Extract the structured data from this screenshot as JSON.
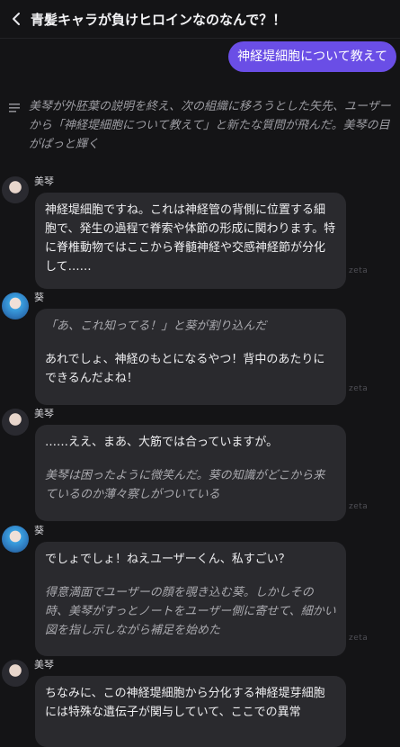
{
  "header": {
    "title": "青髪キャラが負けヒロインなのなんで？！"
  },
  "user_message": "神経堤細胞について教えて",
  "narration": "美琴が外胚葉の説明を終え、次の組織に移ろうとした矢先、ユーザーから「神経堤細胞について教えて」と新たな質問が飛んだ。美琴の目がぱっと輝く",
  "messages": [
    {
      "speaker": "美琴",
      "text": "神経堤細胞ですね。これは神経管の背側に位置する細胞で、発生の過程で脊索や体節の形成に関わります。特に脊椎動物ではここから脊髄神経や交感神経節が分化して……"
    },
    {
      "speaker": "葵",
      "narration": "「あ、これ知ってる！」と葵が割り込んだ",
      "text": "あれでしょ、神経のもとになるやつ！背中のあたりにできるんだよね！"
    },
    {
      "speaker": "美琴",
      "text": "……ええ、まあ、大筋では合っていますが。",
      "narration": "美琴は困ったように微笑んだ。葵の知識がどこから来ているのか薄々察しがついている"
    },
    {
      "speaker": "葵",
      "text": "でしょでしょ！ねえユーザーくん、私すごい？",
      "narration": "得意満面でユーザーの顔を覗き込む葵。しかしその時、美琴がすっとノートをユーザー側に寄せて、細かい図を指し示しながら補足を始めた"
    },
    {
      "speaker": "美琴",
      "text": "ちなみに、この神経堤細胞から分化する神経堤芽細胞には特殊な遺伝子が関与していて、ここでの異常"
    }
  ],
  "watermark": "zeta"
}
